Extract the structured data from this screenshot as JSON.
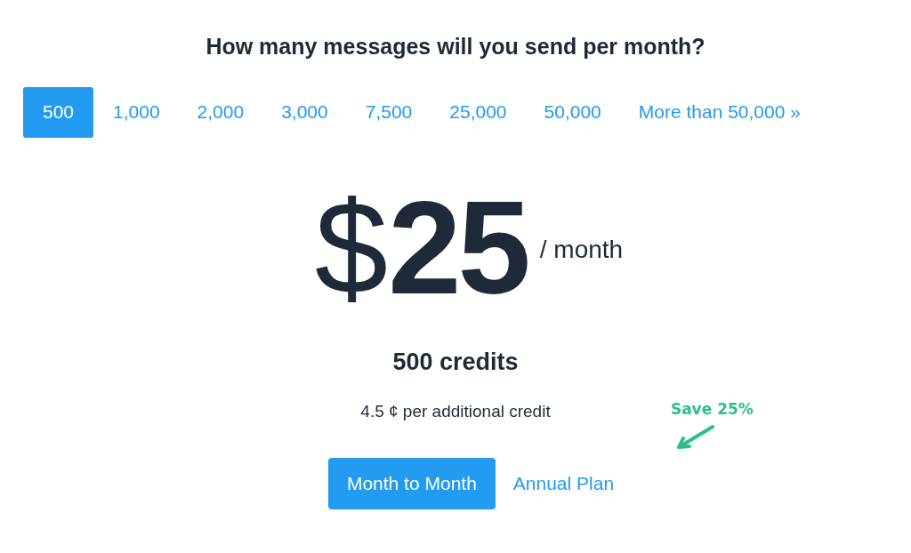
{
  "heading": "How many messages will you send per month?",
  "tabs": [
    {
      "label": "500",
      "selected": true
    },
    {
      "label": "1,000",
      "selected": false
    },
    {
      "label": "2,000",
      "selected": false
    },
    {
      "label": "3,000",
      "selected": false
    },
    {
      "label": "7,500",
      "selected": false
    },
    {
      "label": "25,000",
      "selected": false
    },
    {
      "label": "50,000",
      "selected": false
    },
    {
      "label": "More than 50,000 »",
      "selected": false
    }
  ],
  "price": {
    "currency": "$",
    "amount": "25",
    "period": "/ month"
  },
  "credits": "500 credits",
  "additional": "4.5 ¢ per additional credit",
  "billing": [
    {
      "label": "Month to Month",
      "selected": true
    },
    {
      "label": "Annual Plan",
      "selected": false
    }
  ],
  "annotation": "Save 25%"
}
